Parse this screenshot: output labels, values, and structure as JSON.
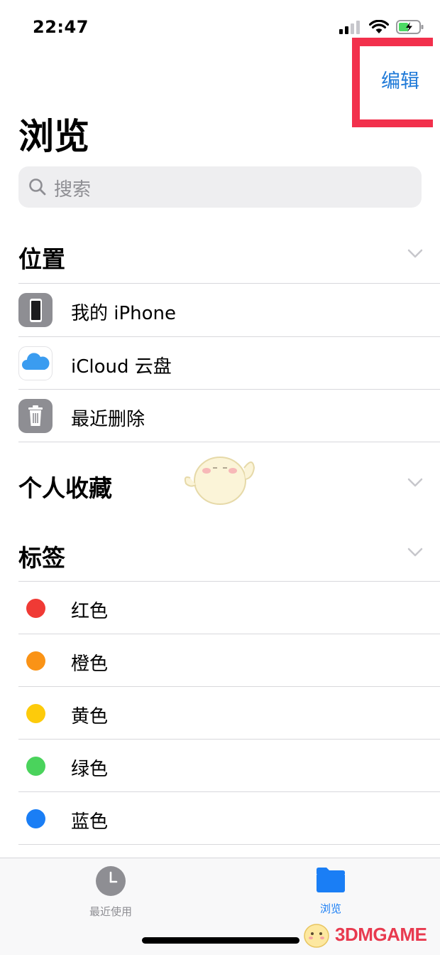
{
  "status_bar": {
    "time": "22:47"
  },
  "nav": {
    "edit_label": "编辑",
    "title": "浏览"
  },
  "search": {
    "placeholder": "搜索"
  },
  "locations": {
    "title": "位置",
    "items": [
      {
        "label": "我的 iPhone",
        "icon": "iphone-icon"
      },
      {
        "label": "iCloud 云盘",
        "icon": "icloud-icon"
      },
      {
        "label": "最近删除",
        "icon": "trash-icon"
      }
    ]
  },
  "favorites": {
    "title": "个人收藏"
  },
  "tags": {
    "title": "标签",
    "items": [
      {
        "label": "红色",
        "color": "#f03a35"
      },
      {
        "label": "橙色",
        "color": "#fa9316"
      },
      {
        "label": "黄色",
        "color": "#fdcb0b"
      },
      {
        "label": "绿色",
        "color": "#4ad35c"
      },
      {
        "label": "蓝色",
        "color": "#1a7ef5"
      }
    ]
  },
  "tab_bar": {
    "tabs": [
      {
        "label": "最近使用",
        "icon": "clock-icon",
        "selected": false
      },
      {
        "label": "浏览",
        "icon": "folder-icon",
        "selected": true
      }
    ]
  },
  "watermark": {
    "text": "3DMGAME"
  },
  "colors": {
    "accent": "#1f7ad8",
    "highlight": "#f2304c",
    "separator": "#d8d8dc"
  }
}
